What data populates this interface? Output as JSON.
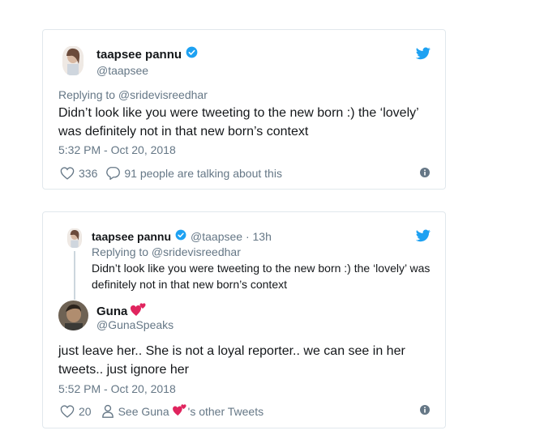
{
  "tweet1": {
    "name": "taapsee pannu",
    "handle": "@taapsee",
    "replying_to": "Replying to @sridevisreedhar",
    "text_line1": "Didn’t look like you were tweeting to the new born :) the ‘lovely’",
    "text_line2": "was definitely not in that new born’s context",
    "timestamp": "5:32 PM - Oct 20, 2018",
    "likes": "336",
    "talking": "91 people are talking about this"
  },
  "tweet2": {
    "quoted": {
      "name": "taapsee pannu",
      "handle_time": "@taapsee · 13h",
      "replying_to": "Replying to @sridevisreedhar",
      "text_line1": "Didn’t look like you were tweeting to the new born :) the ‘lovely’ was",
      "text_line2": "definitely not in that new born’s context"
    },
    "name": "Guna",
    "handle": "@GunaSpeaks",
    "text_line1": "just leave her.. She is not a loyal reporter.. we can see in her",
    "text_line2": "tweets.. just ignore her",
    "timestamp": "5:52 PM - Oct 20, 2018",
    "likes": "20",
    "see_other_prefix": "See Guna",
    "see_other_suffix": "'s other Tweets"
  },
  "colors": {
    "twitter_blue": "#1da1f2",
    "muted_gray": "#657786",
    "heart_red": "#e0245e",
    "border": "#e1e8ed"
  },
  "icons": [
    "twitter-bird-icon",
    "verified-badge-icon",
    "heart-outline-icon",
    "reply-bubble-icon",
    "person-icon",
    "info-icon",
    "two-hearts-emoji-icon"
  ]
}
